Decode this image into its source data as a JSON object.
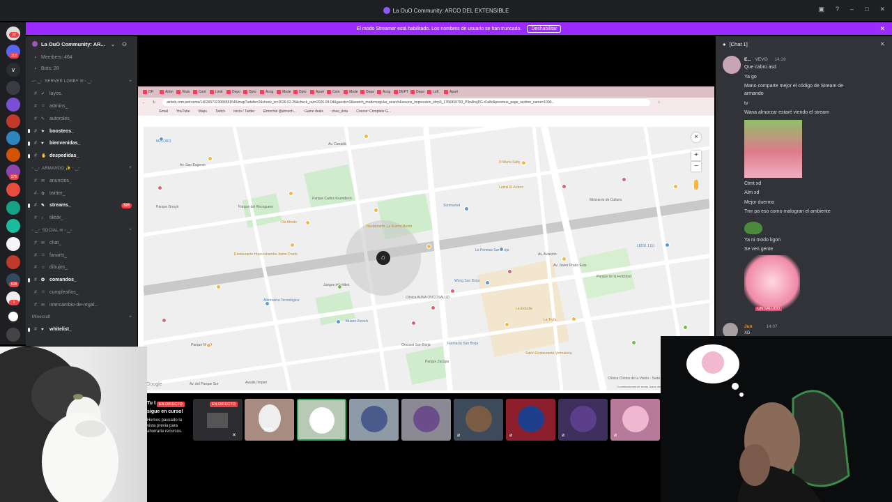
{
  "window": {
    "title": "La OuO Community: ARCO DEL EXTENSIBLE"
  },
  "banner": {
    "message": "El modo Streamer está habilitado. Los nombres de usuario se han truncado.",
    "button": "Deshabilitar"
  },
  "rail": {
    "badges": [
      "22",
      "112",
      "275",
      "528",
      "1"
    ]
  },
  "sidebar": {
    "server_name": "La OuO Community: AR...",
    "members": "Members: 464",
    "bots": "Bots: 28",
    "channels": [
      {
        "type": "cat",
        "label": "⌐╴‿╴  SERVER LOBBY ✉ ╴‿╴"
      },
      {
        "type": "ch",
        "emo": "✔",
        "label": "layos.",
        "bold": false
      },
      {
        "type": "ch",
        "emo": "☺",
        "label": "admins_",
        "bold": false
      },
      {
        "type": "ch",
        "emo": "✎",
        "label": "autoroles_",
        "bold": false
      },
      {
        "type": "ch",
        "emo": "✦",
        "label": "boosteos_",
        "bold": true
      },
      {
        "type": "ch",
        "emo": "♥",
        "label": "bienvenidas_",
        "bold": true
      },
      {
        "type": "ch",
        "emo": "✋",
        "label": "despedidas_",
        "bold": true
      },
      {
        "type": "cat",
        "label": "╴‿╴  ARMANDO ✨ ╴‿╴"
      },
      {
        "type": "ch",
        "emo": "✉",
        "label": "anuncios_",
        "bold": false
      },
      {
        "type": "ch",
        "emo": "✿",
        "label": "twitter_",
        "bold": false
      },
      {
        "type": "ch",
        "emo": "✎",
        "label": "streams_",
        "bold": true,
        "pill": "328"
      },
      {
        "type": "ch",
        "emo": "♪",
        "label": "tiktok_",
        "bold": false
      },
      {
        "type": "cat",
        "label": "╴‿╴  SOCIAL ✉ ╴‿╴"
      },
      {
        "type": "ch",
        "emo": "✉",
        "label": "chat_",
        "bold": false
      },
      {
        "type": "ch",
        "emo": "☺",
        "label": "fanarts_",
        "bold": false
      },
      {
        "type": "ch",
        "emo": "☺",
        "label": "dibujos_",
        "bold": false
      },
      {
        "type": "ch",
        "emo": "✪",
        "label": "comandos_",
        "bold": true
      },
      {
        "type": "ch",
        "emo": "☺",
        "label": "cumpleaños_",
        "bold": false
      },
      {
        "type": "ch",
        "emo": "✉",
        "label": "intercambio-de-regal...",
        "bold": false
      },
      {
        "type": "cat",
        "label": "Minecraft"
      },
      {
        "type": "ch",
        "emo": "♥",
        "label": "whitelist_",
        "bold": true
      }
    ]
  },
  "browser": {
    "tabs": [
      "DH",
      "Airbn",
      "Vista",
      "Cont",
      "Limit",
      "Depo",
      "Dpto",
      "Acog",
      "Mode",
      "Dpto",
      "Apart",
      "Com",
      "Mode",
      "Depa",
      "Acog",
      "DEPT",
      "Depa",
      "Loft",
      "Apart"
    ],
    "url": "airbnb.com.pe/rooms/1462657323089551545/map?adults=2&check_in=2026-02-25&check_out=2026-03-04&guests=2&search_mode=regular_search&source_impression_id=p3_1766959793_P3nAhsjPG-rFa8c&previous_page_section_name=1000...",
    "bookmarks": [
      "Gmail",
      "YouTube",
      "Maps",
      "Twitch",
      "Inicio / Twitter",
      "Elmochal @elmoch...",
      "Game deals",
      "chao_dota",
      "Course: Complete G..."
    ]
  },
  "map": {
    "labels": [
      {
        "t": "MAJORO",
        "c": "blue"
      },
      {
        "t": "Av. Canadá",
        "c": ""
      },
      {
        "t": "Av. San Eugenio",
        "c": ""
      },
      {
        "t": "Parque Gooyb",
        "c": ""
      },
      {
        "t": "Parque del Recoguero",
        "c": ""
      },
      {
        "t": "Parque Carlos Krumdieck",
        "c": ""
      },
      {
        "t": "De Afredo",
        "c": "orange"
      },
      {
        "t": "Sunmarket",
        "c": "blue"
      },
      {
        "t": "D María Salty",
        "c": "orange"
      },
      {
        "t": "Lestal El Ardero",
        "c": "orange"
      },
      {
        "t": "Ministerio de Cultura",
        "c": ""
      },
      {
        "t": "Restaurante La Buena Mente",
        "c": "orange"
      },
      {
        "t": "Restaurante Huancabamba Jaime Prado",
        "c": "orange"
      },
      {
        "t": "La Pemitas San Borja",
        "c": "blue"
      },
      {
        "t": "LEDU 1 (1)",
        "c": "blue"
      },
      {
        "t": "Parque de la Felicidad",
        "c": ""
      },
      {
        "t": "Juegos infantiles",
        "c": ""
      },
      {
        "t": "Wong San Borja",
        "c": "blue"
      },
      {
        "t": "Clínica AUNA ONCOSALUD",
        "c": ""
      },
      {
        "t": "Alternativa Tecnológica",
        "c": "blue"
      },
      {
        "t": "Museo Zoroch",
        "c": "blue"
      },
      {
        "t": "La Estadia",
        "c": "orange"
      },
      {
        "t": "Parque Nº 49",
        "c": ""
      },
      {
        "t": "La Trufa",
        "c": "orange"
      },
      {
        "t": "Oncosol San Borja",
        "c": ""
      },
      {
        "t": "Farmacia San Borja",
        "c": "blue"
      },
      {
        "t": "Parque Zacapa",
        "c": ""
      },
      {
        "t": "Salón Restaurante Vermaleria",
        "c": "orange"
      },
      {
        "t": "Av. del Parque Sur",
        "c": ""
      },
      {
        "t": "Clínica Clínica de la Visión - Sede",
        "c": ""
      },
      {
        "t": "Awaiku Imperi",
        "c": ""
      },
      {
        "t": "Av. Aviación",
        "c": ""
      },
      {
        "t": "Av. Javier Prado Este",
        "c": ""
      }
    ],
    "footer": "Combinaciones de teclas   Datos del mapa ©2026 Google   50 m   Términos",
    "google": "Google",
    "zoom_in": "+",
    "zoom_out": "−",
    "close": "×"
  },
  "strip": {
    "live1": "EN DIRECTO",
    "live2": "EN DIRECTO",
    "paused_title": "Tu t",
    "paused_line1": "sigue en curso!",
    "paused_line2": "Hemos pausado la vista previa para ahorrarte recursos.",
    "no_label": "NO"
  },
  "chat": {
    "title": "[Chat 1]",
    "author1": "E...",
    "author1_tag": "VEVO",
    "time1": "14:28",
    "lines": [
      "Que cabro asd",
      "Ya go",
      "Mano comparte mejor el código de Stream de",
      "armando",
      "tv",
      "Wana almorzar estaré viendo el stream",
      "Ctmt xd",
      "Alm xd",
      "Mejor duermo",
      "Tmr pa eso como malogran el ambiente",
      "Ya ni modo kgon",
      "Se ven gente"
    ],
    "sticker_text": "UN SALUDO",
    "author2": "Jun",
    "time2": "14:07",
    "last_line": "XD"
  },
  "colors": {
    "accent": "#9b2bff",
    "danger": "#f23f43",
    "sidebar": "#2b2d31",
    "chat": "#313338"
  }
}
